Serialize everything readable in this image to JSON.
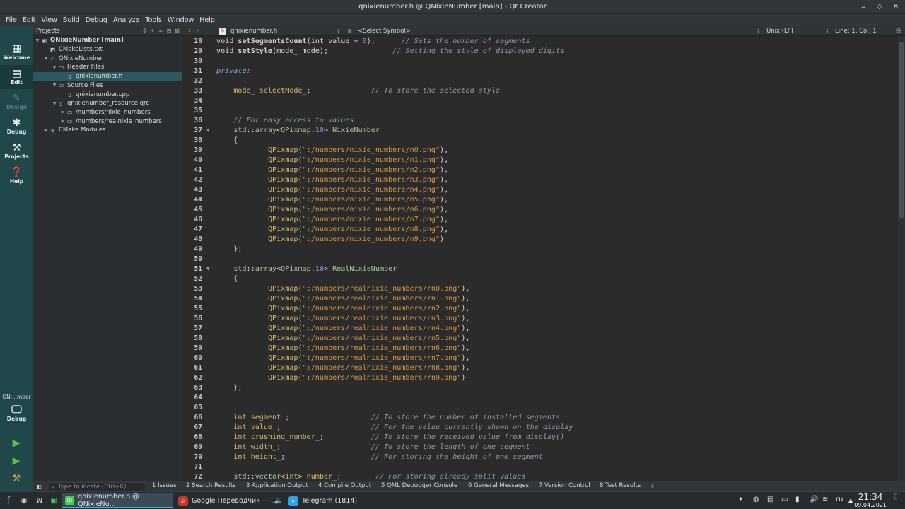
{
  "window": {
    "title": "qnixienumber.h @ QNixieNumber [main] - Qt Creator"
  },
  "menu": [
    "File",
    "Edit",
    "View",
    "Build",
    "Debug",
    "Analyze",
    "Tools",
    "Window",
    "Help"
  ],
  "modes": [
    {
      "label": "Welcome",
      "icon": "grid-icon"
    },
    {
      "label": "Edit",
      "icon": "edit-icon"
    },
    {
      "label": "Design",
      "icon": "pen-icon"
    },
    {
      "label": "Debug",
      "icon": "bug-icon"
    },
    {
      "label": "Projects",
      "icon": "wrench-icon"
    },
    {
      "label": "Help",
      "icon": "help-icon"
    }
  ],
  "kit": {
    "name": "QNi...mber",
    "mode": "Debug"
  },
  "projects": {
    "header": "Projects",
    "tree": [
      {
        "label": "QNixieNumber [main]",
        "depth": 0,
        "expanded": true,
        "icon": "cmake-project-icon"
      },
      {
        "label": "CMakeLists.txt",
        "depth": 1,
        "icon": "cmake-file-icon"
      },
      {
        "label": "QNixieNumber",
        "depth": 1,
        "expanded": true,
        "icon": "target-icon"
      },
      {
        "label": "Header Files",
        "depth": 2,
        "expanded": true,
        "icon": "folder-icon"
      },
      {
        "label": "qnixienumber.h",
        "depth": 3,
        "icon": "header-file-icon",
        "selected": true
      },
      {
        "label": "Source Files",
        "depth": 2,
        "expanded": true,
        "icon": "folder-icon"
      },
      {
        "label": "qnixienumber.cpp",
        "depth": 3,
        "icon": "cpp-file-icon"
      },
      {
        "label": "qnixienumber_resource.qrc",
        "depth": 2,
        "expanded": true,
        "icon": "qrc-file-icon"
      },
      {
        "label": "/numbers/nixie_numbers",
        "depth": 3,
        "collapsed": true,
        "icon": "folder-icon"
      },
      {
        "label": "/numbers/realnixie_numbers",
        "depth": 3,
        "collapsed": true,
        "icon": "folder-icon"
      },
      {
        "label": "CMake Modules",
        "depth": 1,
        "collapsed": true,
        "icon": "cmake-modules-icon"
      }
    ]
  },
  "editor": {
    "file": "qnixienumber.h",
    "symbol": "<Select Symbol>",
    "eol": "Unix (LF)",
    "cursor": "Line: 1, Col: 1"
  },
  "code_lines": [
    {
      "n": "28",
      "parts": [
        [
          "kw",
          "void "
        ],
        [
          "fn",
          "setSegmentsCount"
        ],
        [
          "kw",
          "(int value = "
        ],
        [
          "num",
          "0"
        ],
        [
          "kw",
          ");      "
        ],
        [
          "cmt",
          "// Sets the number of segments"
        ]
      ]
    },
    {
      "n": "29",
      "parts": [
        [
          "kw",
          "void "
        ],
        [
          "fn",
          "setStyle"
        ],
        [
          "kw",
          "(mode_ mode);               "
        ],
        [
          "cmt",
          "// Setting the style of displayed digits"
        ]
      ]
    },
    {
      "n": "30",
      "parts": []
    },
    {
      "n": "31",
      "parts": [
        [
          "acc",
          "private:"
        ]
      ]
    },
    {
      "n": "32",
      "parts": []
    },
    {
      "n": "33",
      "parts": [
        [
          "kw",
          "    "
        ],
        [
          "ty",
          "mode_"
        ],
        [
          "kw",
          " "
        ],
        [
          "ty",
          "selectMode_"
        ],
        [
          "kw",
          ";              "
        ],
        [
          "cmt",
          "// To store the selected style"
        ]
      ]
    },
    {
      "n": "34",
      "parts": []
    },
    {
      "n": "35",
      "parts": []
    },
    {
      "n": "36",
      "parts": [
        [
          "kw",
          "    "
        ],
        [
          "cmt",
          "// For easy access to values"
        ]
      ]
    },
    {
      "n": "37",
      "fold": true,
      "parts": [
        [
          "kw",
          "    "
        ],
        [
          "cls",
          "std"
        ],
        [
          "kw",
          "::"
        ],
        [
          "cls",
          "array"
        ],
        [
          "kw",
          "<"
        ],
        [
          "cls",
          "QPixmap"
        ],
        [
          "kw",
          ","
        ],
        [
          "num",
          "10"
        ],
        [
          "kw",
          "> "
        ],
        [
          "cls",
          "NixieNumber"
        ]
      ]
    },
    {
      "n": "38",
      "parts": [
        [
          "kw",
          "    {"
        ]
      ]
    },
    {
      "n": "39",
      "parts": [
        [
          "kw",
          "            "
        ],
        [
          "ty",
          "QPixmap"
        ],
        [
          "kw",
          "("
        ],
        [
          "str",
          "\":/numbers/nixie_numbers/n0.png\""
        ],
        [
          "kw",
          "),"
        ]
      ]
    },
    {
      "n": "40",
      "parts": [
        [
          "kw",
          "            "
        ],
        [
          "ty",
          "QPixmap"
        ],
        [
          "kw",
          "("
        ],
        [
          "str",
          "\":/numbers/nixie_numbers/n1.png\""
        ],
        [
          "kw",
          "),"
        ]
      ]
    },
    {
      "n": "41",
      "parts": [
        [
          "kw",
          "            "
        ],
        [
          "ty",
          "QPixmap"
        ],
        [
          "kw",
          "("
        ],
        [
          "str",
          "\":/numbers/nixie_numbers/n2.png\""
        ],
        [
          "kw",
          "),"
        ]
      ]
    },
    {
      "n": "42",
      "parts": [
        [
          "kw",
          "            "
        ],
        [
          "ty",
          "QPixmap"
        ],
        [
          "kw",
          "("
        ],
        [
          "str",
          "\":/numbers/nixie_numbers/n3.png\""
        ],
        [
          "kw",
          "),"
        ]
      ]
    },
    {
      "n": "43",
      "parts": [
        [
          "kw",
          "            "
        ],
        [
          "ty",
          "QPixmap"
        ],
        [
          "kw",
          "("
        ],
        [
          "str",
          "\":/numbers/nixie_numbers/n4.png\""
        ],
        [
          "kw",
          "),"
        ]
      ]
    },
    {
      "n": "44",
      "parts": [
        [
          "kw",
          "            "
        ],
        [
          "ty",
          "QPixmap"
        ],
        [
          "kw",
          "("
        ],
        [
          "str",
          "\":/numbers/nixie_numbers/n5.png\""
        ],
        [
          "kw",
          "),"
        ]
      ]
    },
    {
      "n": "45",
      "parts": [
        [
          "kw",
          "            "
        ],
        [
          "ty",
          "QPixmap"
        ],
        [
          "kw",
          "("
        ],
        [
          "str",
          "\":/numbers/nixie_numbers/n6.png\""
        ],
        [
          "kw",
          "),"
        ]
      ]
    },
    {
      "n": "46",
      "parts": [
        [
          "kw",
          "            "
        ],
        [
          "ty",
          "QPixmap"
        ],
        [
          "kw",
          "("
        ],
        [
          "str",
          "\":/numbers/nixie_numbers/n7.png\""
        ],
        [
          "kw",
          "),"
        ]
      ]
    },
    {
      "n": "47",
      "parts": [
        [
          "kw",
          "            "
        ],
        [
          "ty",
          "QPixmap"
        ],
        [
          "kw",
          "("
        ],
        [
          "str",
          "\":/numbers/nixie_numbers/n8.png\""
        ],
        [
          "kw",
          "),"
        ]
      ]
    },
    {
      "n": "48",
      "parts": [
        [
          "kw",
          "            "
        ],
        [
          "ty",
          "QPixmap"
        ],
        [
          "kw",
          "("
        ],
        [
          "str",
          "\":/numbers/nixie_numbers/n9.png\""
        ],
        [
          "kw",
          ")"
        ]
      ]
    },
    {
      "n": "49",
      "parts": [
        [
          "kw",
          "    };"
        ]
      ]
    },
    {
      "n": "50",
      "parts": []
    },
    {
      "n": "51",
      "fold": true,
      "parts": [
        [
          "kw",
          "    "
        ],
        [
          "cls",
          "std"
        ],
        [
          "kw",
          "::"
        ],
        [
          "cls",
          "array"
        ],
        [
          "kw",
          "<"
        ],
        [
          "cls",
          "QPixmap"
        ],
        [
          "kw",
          ","
        ],
        [
          "num",
          "10"
        ],
        [
          "kw",
          "> "
        ],
        [
          "cls",
          "RealNixieNumber"
        ]
      ]
    },
    {
      "n": "52",
      "parts": [
        [
          "kw",
          "    {"
        ]
      ]
    },
    {
      "n": "53",
      "parts": [
        [
          "kw",
          "            "
        ],
        [
          "ty",
          "QPixmap"
        ],
        [
          "kw",
          "("
        ],
        [
          "str",
          "\":/numbers/realnixie_numbers/rn0.png\""
        ],
        [
          "kw",
          "),"
        ]
      ]
    },
    {
      "n": "54",
      "parts": [
        [
          "kw",
          "            "
        ],
        [
          "ty",
          "QPixmap"
        ],
        [
          "kw",
          "("
        ],
        [
          "str",
          "\":/numbers/realnixie_numbers/rn1.png\""
        ],
        [
          "kw",
          "),"
        ]
      ]
    },
    {
      "n": "55",
      "parts": [
        [
          "kw",
          "            "
        ],
        [
          "ty",
          "QPixmap"
        ],
        [
          "kw",
          "("
        ],
        [
          "str",
          "\":/numbers/realnixie_numbers/rn2.png\""
        ],
        [
          "kw",
          "),"
        ]
      ]
    },
    {
      "n": "56",
      "parts": [
        [
          "kw",
          "            "
        ],
        [
          "ty",
          "QPixmap"
        ],
        [
          "kw",
          "("
        ],
        [
          "str",
          "\":/numbers/realnixie_numbers/rn3.png\""
        ],
        [
          "kw",
          "),"
        ]
      ]
    },
    {
      "n": "57",
      "parts": [
        [
          "kw",
          "            "
        ],
        [
          "ty",
          "QPixmap"
        ],
        [
          "kw",
          "("
        ],
        [
          "str",
          "\":/numbers/realnixie_numbers/rn4.png\""
        ],
        [
          "kw",
          "),"
        ]
      ]
    },
    {
      "n": "58",
      "parts": [
        [
          "kw",
          "            "
        ],
        [
          "ty",
          "QPixmap"
        ],
        [
          "kw",
          "("
        ],
        [
          "str",
          "\":/numbers/realnixie_numbers/rn5.png\""
        ],
        [
          "kw",
          "),"
        ]
      ]
    },
    {
      "n": "59",
      "parts": [
        [
          "kw",
          "            "
        ],
        [
          "ty",
          "QPixmap"
        ],
        [
          "kw",
          "("
        ],
        [
          "str",
          "\":/numbers/realnixie_numbers/rn6.png\""
        ],
        [
          "kw",
          "),"
        ]
      ]
    },
    {
      "n": "60",
      "parts": [
        [
          "kw",
          "            "
        ],
        [
          "ty",
          "QPixmap"
        ],
        [
          "kw",
          "("
        ],
        [
          "str",
          "\":/numbers/realnixie_numbers/rn7.png\""
        ],
        [
          "kw",
          "),"
        ]
      ]
    },
    {
      "n": "61",
      "parts": [
        [
          "kw",
          "            "
        ],
        [
          "ty",
          "QPixmap"
        ],
        [
          "kw",
          "("
        ],
        [
          "str",
          "\":/numbers/realnixie_numbers/rn8.png\""
        ],
        [
          "kw",
          "),"
        ]
      ]
    },
    {
      "n": "62",
      "parts": [
        [
          "kw",
          "            "
        ],
        [
          "ty",
          "QPixmap"
        ],
        [
          "kw",
          "("
        ],
        [
          "str",
          "\":/numbers/realnixie_numbers/rn9.png\""
        ],
        [
          "kw",
          ")"
        ]
      ]
    },
    {
      "n": "63",
      "parts": [
        [
          "kw",
          "    };"
        ]
      ]
    },
    {
      "n": "64",
      "parts": []
    },
    {
      "n": "65",
      "parts": []
    },
    {
      "n": "66",
      "parts": [
        [
          "kw",
          "    "
        ],
        [
          "ty",
          "int"
        ],
        [
          "kw",
          " "
        ],
        [
          "ty",
          "segment_"
        ],
        [
          "kw",
          ";                   "
        ],
        [
          "cmt",
          "// To store the number of installed segments"
        ]
      ]
    },
    {
      "n": "67",
      "parts": [
        [
          "kw",
          "    "
        ],
        [
          "ty",
          "int"
        ],
        [
          "kw",
          " "
        ],
        [
          "ty",
          "value_"
        ],
        [
          "kw",
          ";                     "
        ],
        [
          "cmt",
          "// For the value currently shown on the display"
        ]
      ]
    },
    {
      "n": "68",
      "parts": [
        [
          "kw",
          "    "
        ],
        [
          "ty",
          "int"
        ],
        [
          "kw",
          " "
        ],
        [
          "ty",
          "crushing_number_"
        ],
        [
          "kw",
          ";           "
        ],
        [
          "cmt",
          "// To store the received value from display()"
        ]
      ]
    },
    {
      "n": "69",
      "parts": [
        [
          "kw",
          "    "
        ],
        [
          "ty",
          "int"
        ],
        [
          "kw",
          " "
        ],
        [
          "ty",
          "width_"
        ],
        [
          "kw",
          ";                     "
        ],
        [
          "cmt",
          "// To store the length of one segment"
        ]
      ]
    },
    {
      "n": "70",
      "parts": [
        [
          "kw",
          "    "
        ],
        [
          "ty",
          "int"
        ],
        [
          "kw",
          " "
        ],
        [
          "ty",
          "height_"
        ],
        [
          "kw",
          ";                    "
        ],
        [
          "cmt",
          "// For storing the height of one segment"
        ]
      ]
    },
    {
      "n": "71",
      "parts": []
    },
    {
      "n": "72",
      "parts": [
        [
          "kw",
          "    "
        ],
        [
          "cls",
          "std"
        ],
        [
          "kw",
          "::"
        ],
        [
          "cls",
          "vector"
        ],
        [
          "kw",
          "<"
        ],
        [
          "ty",
          "int"
        ],
        [
          "kw",
          "> "
        ],
        [
          "ty",
          "number_"
        ],
        [
          "kw",
          ";        "
        ],
        [
          "cmt",
          "// For storing already split values"
        ]
      ]
    }
  ],
  "output": {
    "locator_placeholder": "Type to locate (Ctrl+K)",
    "tabs": [
      "1 Issues",
      "2 Search Results",
      "3 Application Output",
      "4 Compile Output",
      "5 QML Debugger Console",
      "6 General Messages",
      "7 Version Control",
      "8 Test Results"
    ]
  },
  "taskbar": {
    "tasks": [
      {
        "label": "qnixienumber.h @ QNixieNu...",
        "active": true,
        "icon": "qtcreator-icon",
        "color": "#41cd52"
      },
      {
        "label": "Google Переводчик — ...",
        "active": false,
        "icon": "browser-icon",
        "color": "#c0392b"
      },
      {
        "label": "Telegram (1814)",
        "active": false,
        "icon": "telegram-icon",
        "color": "#2ca5e0"
      }
    ],
    "lang": "ru",
    "time": "21:34",
    "date": "09.04.2021"
  }
}
